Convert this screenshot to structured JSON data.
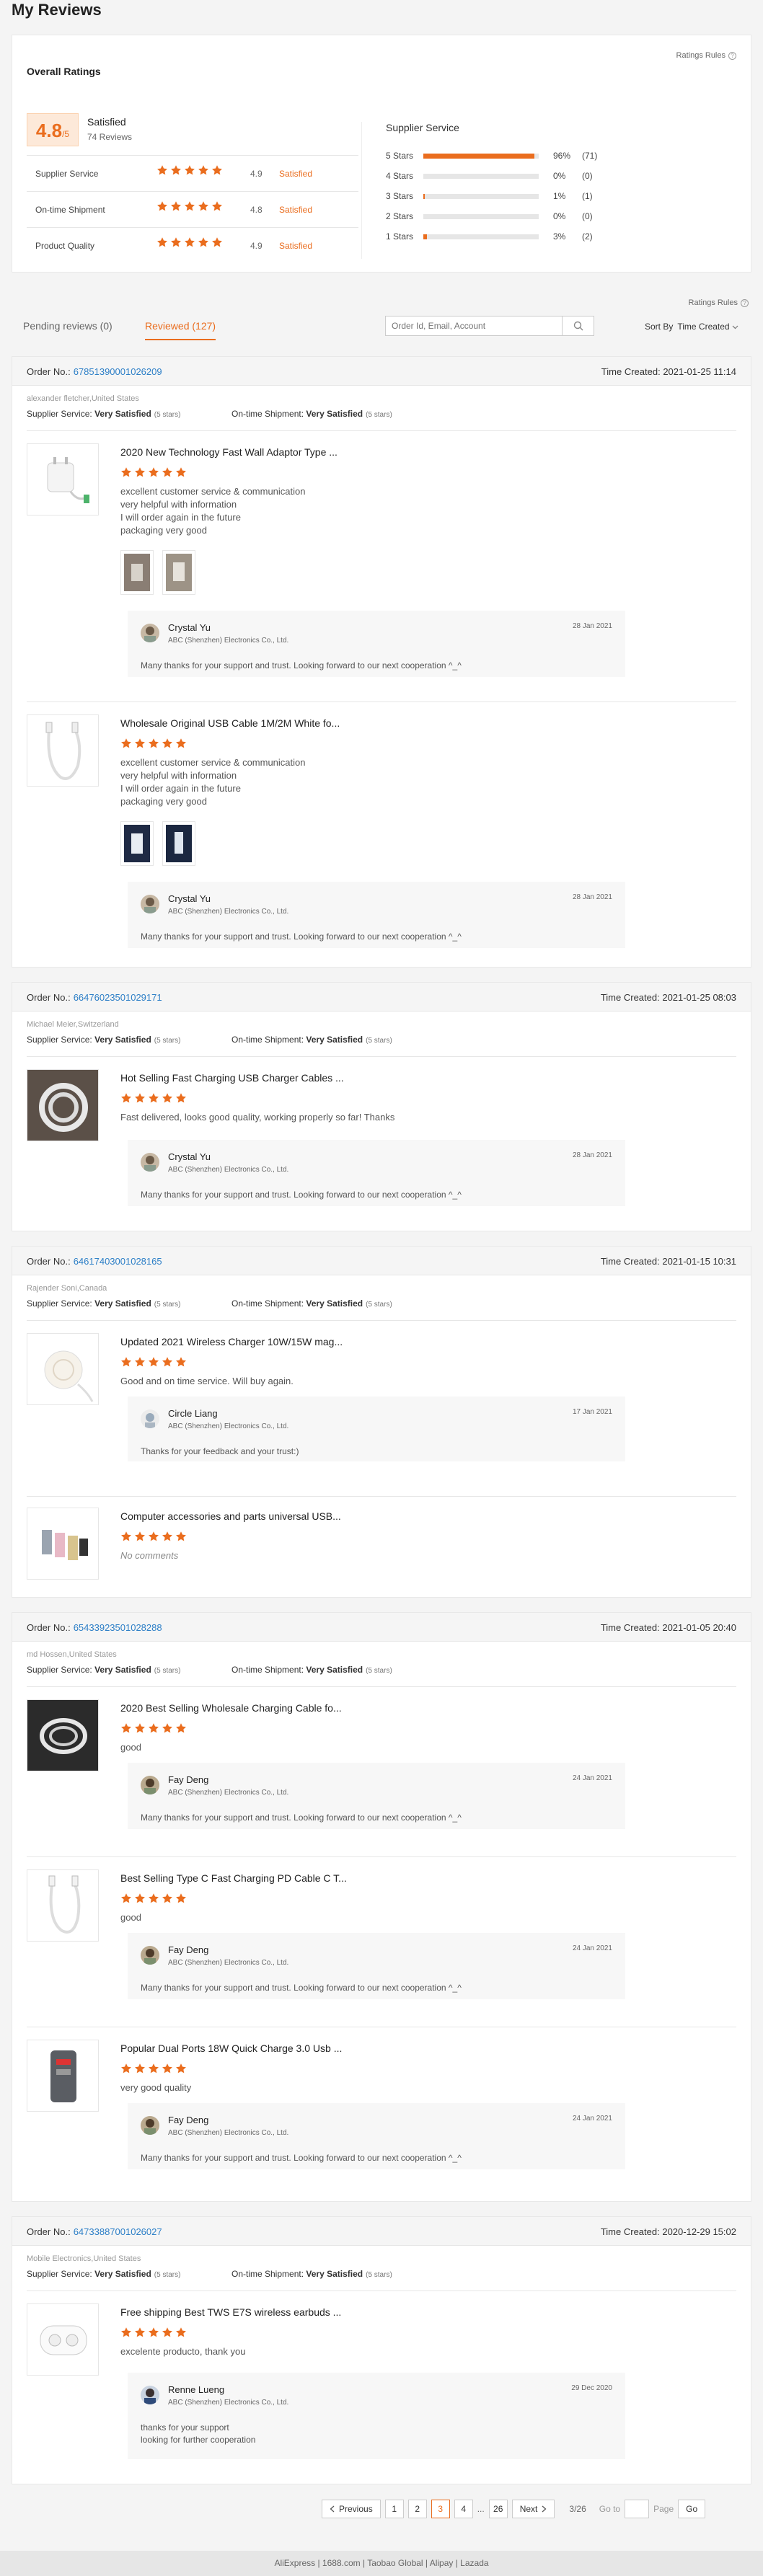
{
  "page": {
    "title": "My Reviews"
  },
  "overall": {
    "rules_link": "Ratings Rules",
    "heading": "Overall Ratings",
    "score": "4.8",
    "score_out_of": "/5",
    "satisfaction": "Satisfied",
    "reviews_count": "74 Reviews",
    "metrics": [
      {
        "label": "Supplier Service",
        "stars": 5,
        "value": "4.9",
        "status": "Satisfied"
      },
      {
        "label": "On-time Shipment",
        "stars": 5,
        "value": "4.8",
        "status": "Satisfied"
      },
      {
        "label": "Product Quality",
        "stars": 5,
        "value": "4.9",
        "status": "Satisfied"
      }
    ],
    "distribution_title": "Supplier Service",
    "distribution": [
      {
        "label": "5 Stars",
        "percent": 96,
        "percent_text": "96%",
        "count": "(71)"
      },
      {
        "label": "4 Stars",
        "percent": 0,
        "percent_text": "0%",
        "count": "(0)"
      },
      {
        "label": "3 Stars",
        "percent": 1,
        "percent_text": "1%",
        "count": "(1)"
      },
      {
        "label": "2 Stars",
        "percent": 0,
        "percent_text": "0%",
        "count": "(0)"
      },
      {
        "label": "1 Stars",
        "percent": 3,
        "percent_text": "3%",
        "count": "(2)"
      }
    ]
  },
  "toolbar": {
    "rules_link": "Ratings Rules",
    "tab_pending": "Pending reviews (0)",
    "tab_reviewed": "Reviewed (127)",
    "search_placeholder": "Order Id, Email, Account",
    "sort_label": "Sort By",
    "sort_value": "Time Created"
  },
  "labels": {
    "order_no": "Order No.:",
    "time_created": "Time Created:",
    "supplier_service": "Supplier Service:",
    "ontime_shipment": "On-time Shipment:",
    "very_satisfied": "Very Satisfied",
    "five_stars": "(5 stars)",
    "supplier_company": "ABC (Shenzhen) Electronics Co., Ltd.",
    "thanks_text": "Many thanks for your support and trust. Looking forward to our next cooperation ^_^"
  },
  "orders": [
    {
      "order_no": "67851390001026209",
      "time": "2021-01-25 11:14",
      "buyer": "alexander fletcher,United States",
      "items": [
        {
          "title": "2020 New Technology Fast Wall Adaptor Type ...",
          "comment": "excellent customer service & communication\nvery helpful with information\nI will order again in the future\npackaging very good",
          "reply_name": "Crystal Yu",
          "reply_date": "28 Jan 2021"
        },
        {
          "title": "Wholesale Original USB Cable 1M/2M White fo...",
          "comment": "excellent customer service & communication\nvery helpful with information\nI will order again in the future\npackaging very good",
          "reply_name": "Crystal Yu",
          "reply_date": "28 Jan 2021"
        }
      ]
    },
    {
      "order_no": "66476023501029171",
      "time": "2021-01-25 08:03",
      "buyer": "Michael Meier,Switzerland",
      "items": [
        {
          "title": "Hot Selling Fast Charging USB Charger Cables ...",
          "comment": "Fast delivered, looks good quality, working properly so far! Thanks",
          "reply_name": "Crystal Yu",
          "reply_date": "28 Jan 2021"
        }
      ]
    },
    {
      "order_no": "64617403001028165",
      "time": "2021-01-15 10:31",
      "buyer": "Rajender Soni,Canada",
      "items": [
        {
          "title": "Updated 2021 Wireless Charger 10W/15W mag...",
          "comment": "Good and on time service. Will buy again.",
          "reply_name": "Circle Liang",
          "reply_date": "17 Jan 2021",
          "reply_text": "Thanks for your feedback and your trust:)"
        },
        {
          "title": "Computer accessories and parts universal USB...",
          "comment": "No comments"
        }
      ]
    },
    {
      "order_no": "65433923501028288",
      "time": "2021-01-05 20:40",
      "buyer": "md Hossen,United States",
      "items": [
        {
          "title": "2020 Best Selling Wholesale Charging Cable fo...",
          "comment": "good",
          "reply_name": "Fay Deng",
          "reply_date": "24 Jan 2021"
        },
        {
          "title": "Best Selling Type C Fast Charging PD Cable C T...",
          "comment": "good",
          "reply_name": "Fay Deng",
          "reply_date": "24 Jan 2021"
        },
        {
          "title": "Popular Dual Ports 18W Quick Charge 3.0 Usb ...",
          "comment": "very good quality",
          "reply_name": "Fay Deng",
          "reply_date": "24 Jan 2021"
        }
      ]
    },
    {
      "order_no": "64733887001026027",
      "time": "2020-12-29 15:02",
      "buyer": "Mobile Electronics,United States",
      "items": [
        {
          "title": "Free shipping Best TWS E7S wireless earbuds ...",
          "comment": "excelente producto, thank you",
          "reply_name": "Renne Lueng",
          "reply_date": "29 Dec 2020",
          "reply_text": "thanks for your support\nlooking for further cooperation"
        }
      ]
    }
  ],
  "pager": {
    "prev": "Previous",
    "p1": "1",
    "p2": "2",
    "p3": "3",
    "p4": "4",
    "ellipsis": "...",
    "last": "26",
    "next": "Next",
    "summary": "3/26",
    "goto": "Go to",
    "page": "Page",
    "go": "Go"
  },
  "footer": "AliExpress | 1688.com | Taobao Global | Alipay | Lazada",
  "colors": {
    "accent": "#ea6d1e",
    "link": "#2d7fc7"
  }
}
